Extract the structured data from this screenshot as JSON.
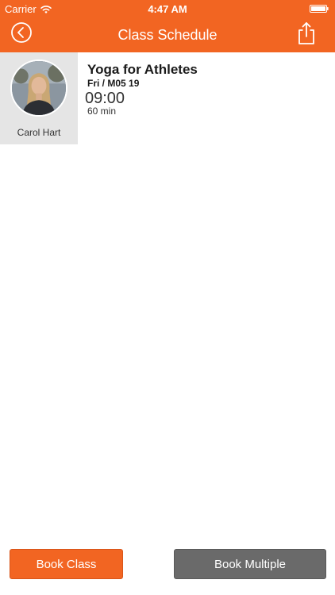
{
  "status_bar": {
    "carrier": "Carrier",
    "time": "4:47 AM"
  },
  "nav": {
    "title": "Class Schedule",
    "back_icon": "chevron-left-circle-icon",
    "share_icon": "share-icon"
  },
  "class_item": {
    "instructor_name": "Carol Hart",
    "name": "Yoga for Athletes",
    "date": "Fri / M05 19",
    "time": "09:00",
    "duration": "60 min"
  },
  "actions": {
    "book_class": "Book Class",
    "book_multiple": "Book Multiple"
  },
  "colors": {
    "accent": "#f26522",
    "secondary_button": "#6a6a6a",
    "instructor_panel": "#e5e5e5"
  }
}
